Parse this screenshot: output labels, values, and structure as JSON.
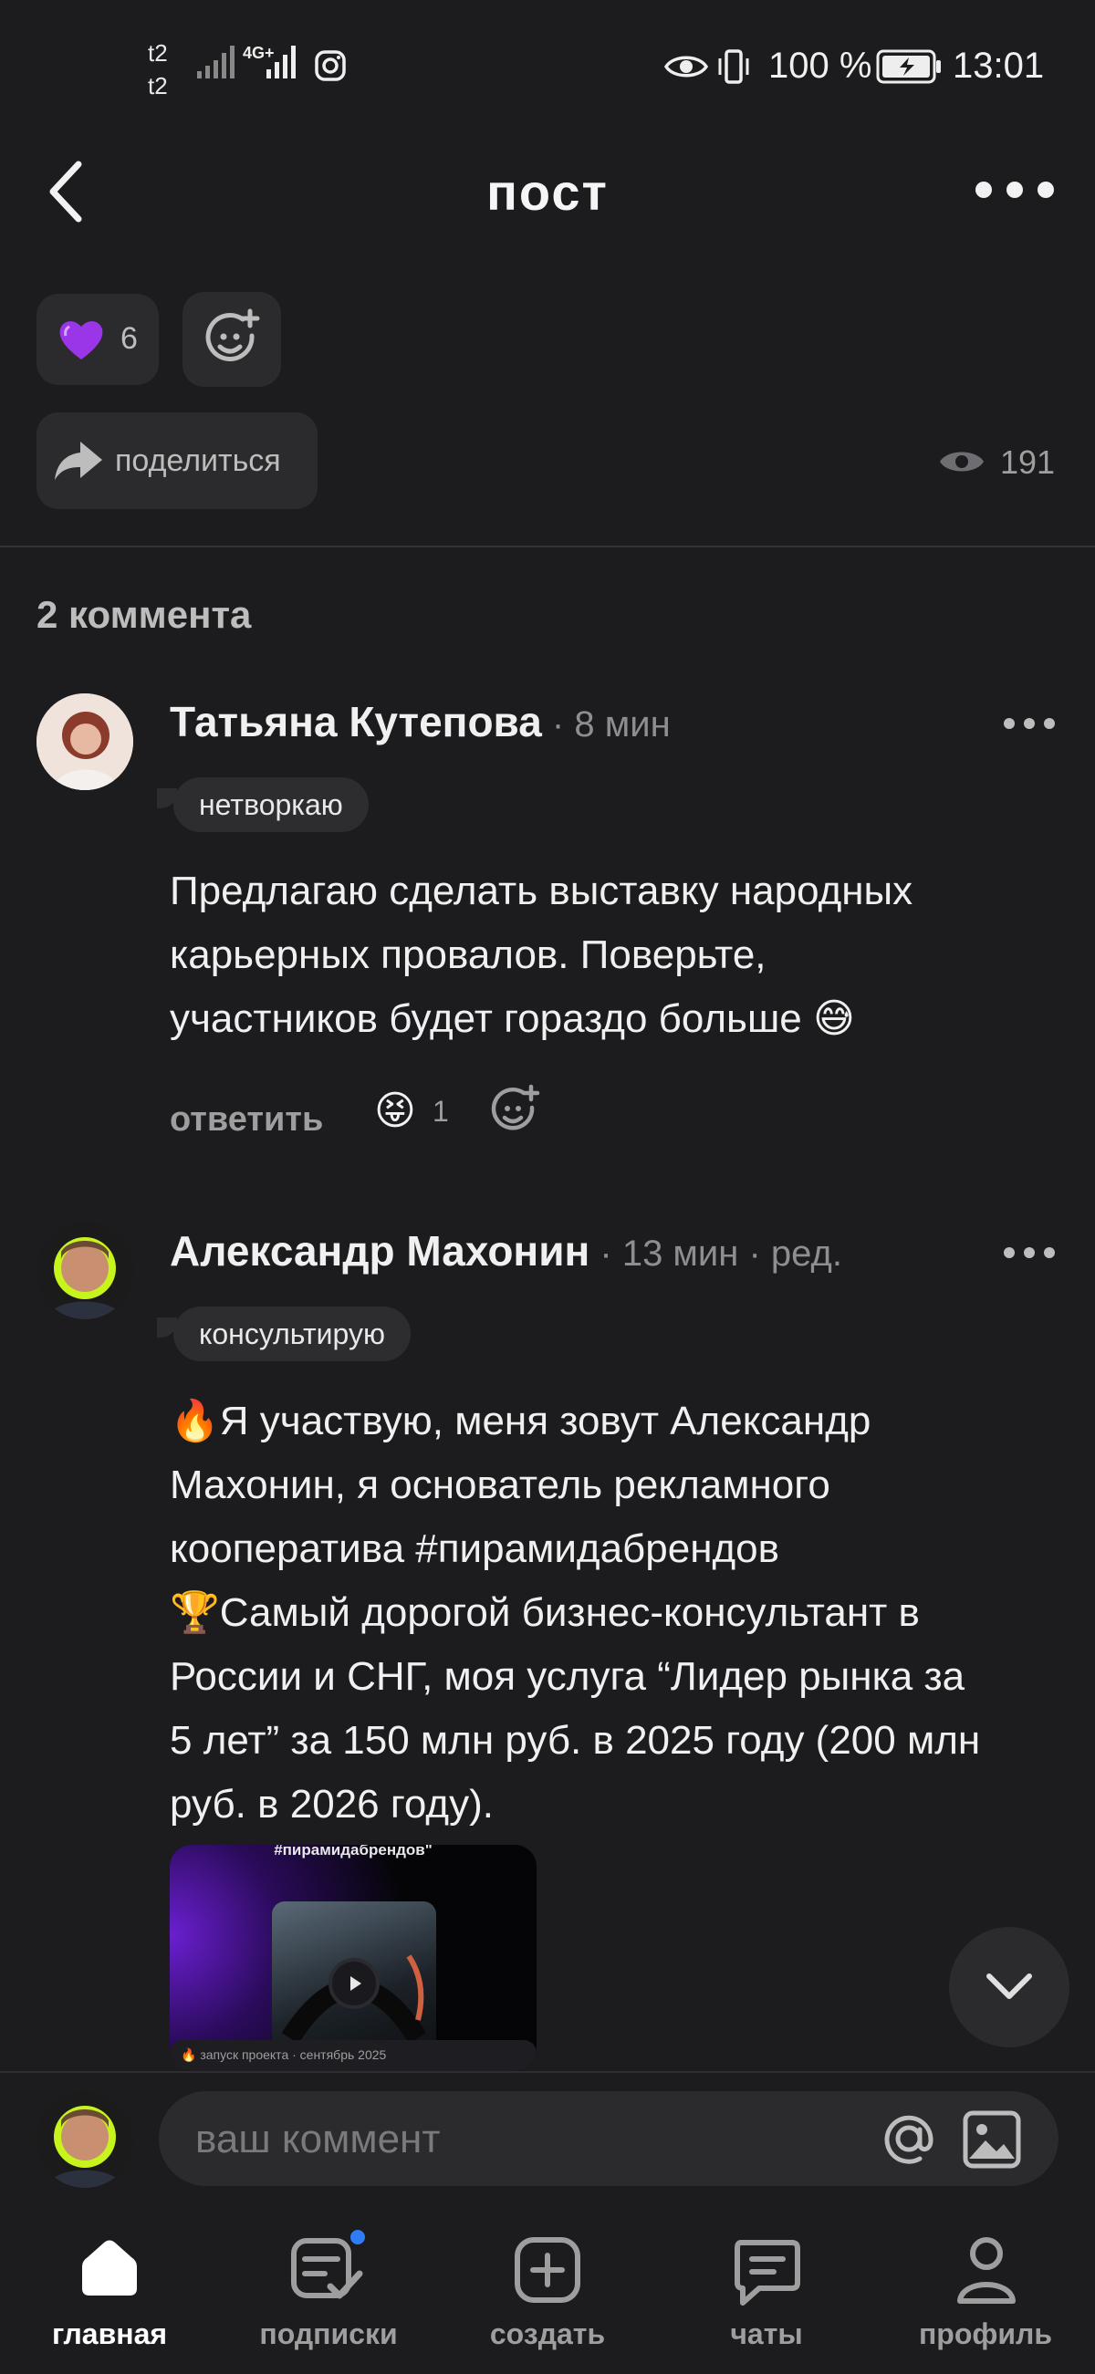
{
  "status_bar": {
    "carrier1": "t2",
    "carrier2": "t2",
    "network": "4G+",
    "battery": "100 %",
    "time": "13:01"
  },
  "header": {
    "title": "пост"
  },
  "reactions": {
    "heart_count": "6"
  },
  "share": {
    "label": "поделиться",
    "views": "191"
  },
  "comments": {
    "count_title": "2 коммента",
    "items": [
      {
        "author": "Татьяна Кутепова",
        "meta": " · 8 мин",
        "tag": "нетворкаю",
        "lines": [
          "Предлагаю сделать выставку народных",
          "карьерных провалов. Поверьте,",
          "участников будет гораздо больше 😅"
        ],
        "reply_label": "ответить",
        "reaction_count": "1"
      },
      {
        "author": "Александр Махонин",
        "meta": " · 13 мин · ред.",
        "tag": "консультирую",
        "lines": [
          "🔥Я участвую, меня зовут Александр",
          "Махонин, я основатель рекламного",
          "кооператива #пирамидабрендов",
          "🏆Самый дорогой бизнес-консультант в",
          "России и СНГ, моя услуга “Лидер рынка за",
          "5 лет” за 150 млн руб. в 2025 году (200 млн",
          "руб. в 2026 году)."
        ],
        "image_caption_top": "#пирамидабрендов\"",
        "image_caption_bottom": "🔥 запуск проекта · сентябрь 2025"
      }
    ]
  },
  "comment_input": {
    "placeholder": "ваш коммент"
  },
  "bottom_nav": [
    {
      "label": "главная",
      "icon": "home-icon",
      "active": true
    },
    {
      "label": "подписки",
      "icon": "subscriptions-icon"
    },
    {
      "label": "создать",
      "icon": "create-icon"
    },
    {
      "label": "чаты",
      "icon": "chats-icon"
    },
    {
      "label": "профиль",
      "icon": "profile-icon"
    }
  ],
  "colors": {
    "background": "#1c1c1e",
    "accent_purple": "#8a2be2",
    "notification_dot": "#2f7cf6"
  }
}
